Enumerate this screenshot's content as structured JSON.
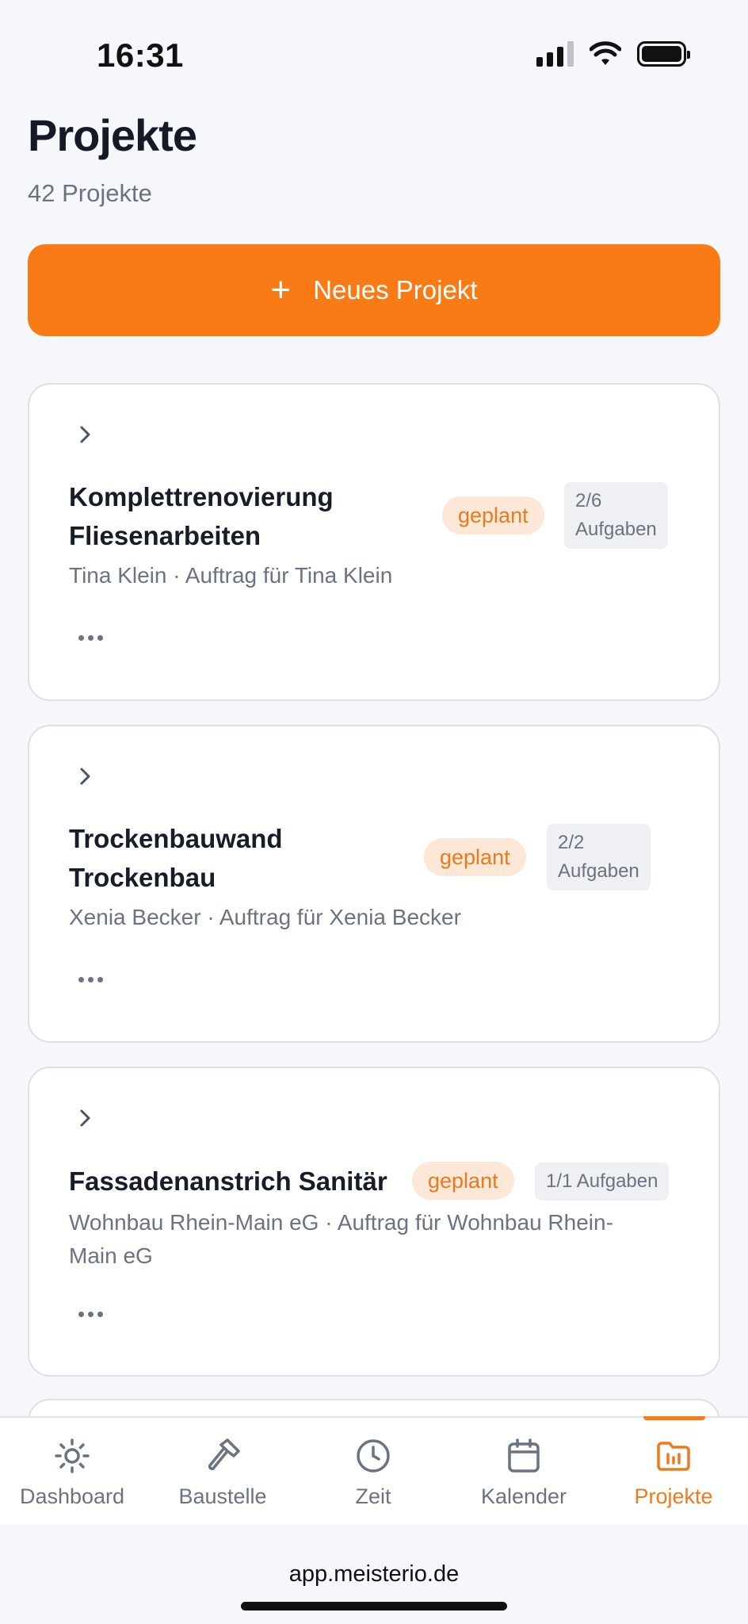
{
  "status_bar": {
    "time": "16:31"
  },
  "header": {
    "title": "Projekte",
    "subtitle": "42 Projekte"
  },
  "new_project_button": {
    "label": "Neues Projekt",
    "icon": "plus-icon"
  },
  "projects": [
    {
      "title_line1": "Komplettrenovierung",
      "title_line2": "Fliesenarbeiten",
      "status": "geplant",
      "tasks_line1": "2/6",
      "tasks_line2": "Aufgaben",
      "subtitle": "Tina Klein · Auftrag für Tina Klein"
    },
    {
      "title_line1": "Trockenbauwand",
      "title_line2": "Trockenbau",
      "status": "geplant",
      "tasks_line1": "2/2",
      "tasks_line2": "Aufgaben",
      "subtitle": "Xenia Becker · Auftrag für Xenia Becker"
    },
    {
      "title": "Fassadenanstrich Sanitär",
      "status": "geplant",
      "tasks": "1/1 Aufgaben",
      "subtitle_line1": "Wohnbau Rhein-Main eG · Auftrag für Wohnbau Rhein-",
      "subtitle_line2": "Main eG"
    }
  ],
  "bottom_nav": [
    {
      "label": "Dashboard",
      "icon": "sun-icon"
    },
    {
      "label": "Baustelle",
      "icon": "hammer-icon"
    },
    {
      "label": "Zeit",
      "icon": "clock-icon"
    },
    {
      "label": "Kalender",
      "icon": "calendar-icon"
    },
    {
      "label": "Projekte",
      "icon": "folder-icon",
      "active": true
    }
  ],
  "browser": {
    "url": "app.meisterio.de"
  },
  "colors": {
    "accent": "#f97b16",
    "badge_bg": "#fde7d6",
    "muted": "#6b7280"
  }
}
